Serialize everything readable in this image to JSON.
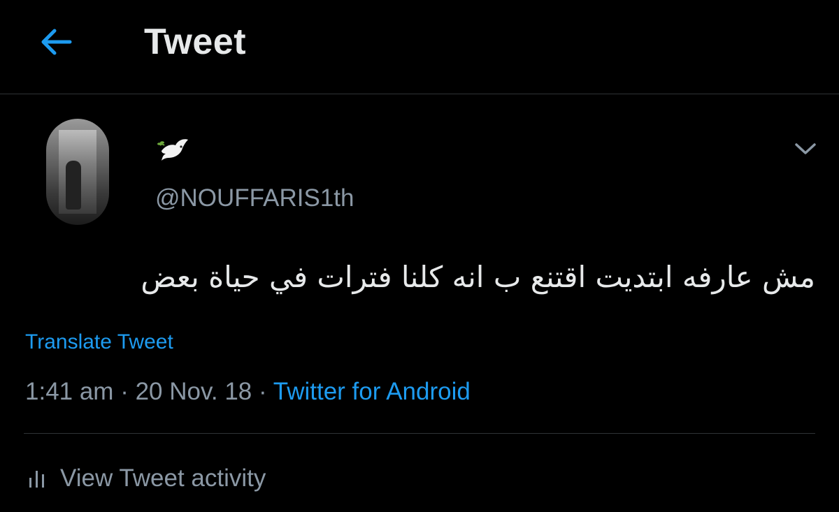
{
  "header": {
    "title": "Tweet",
    "back_icon": "arrow-left-icon"
  },
  "colors": {
    "accent": "#1d9bf0",
    "background": "#000000",
    "secondary_text": "#8b98a5",
    "primary_text": "#e7e9ea"
  },
  "tweet": {
    "display_name_icon": "dove-emoji",
    "handle": "@NOUFFARIS1th",
    "more_icon": "chevron-down-icon",
    "text": "مش عارفه ابتديت اقتنع ب انه كلنا فترات في حياة بعض",
    "translate_label": "Translate Tweet",
    "time": "1:41 am",
    "separator": "·",
    "date": "20 Nov. 18",
    "source": "Twitter for Android"
  },
  "activity": {
    "icon": "bar-chart-icon",
    "label": "View Tweet activity"
  }
}
